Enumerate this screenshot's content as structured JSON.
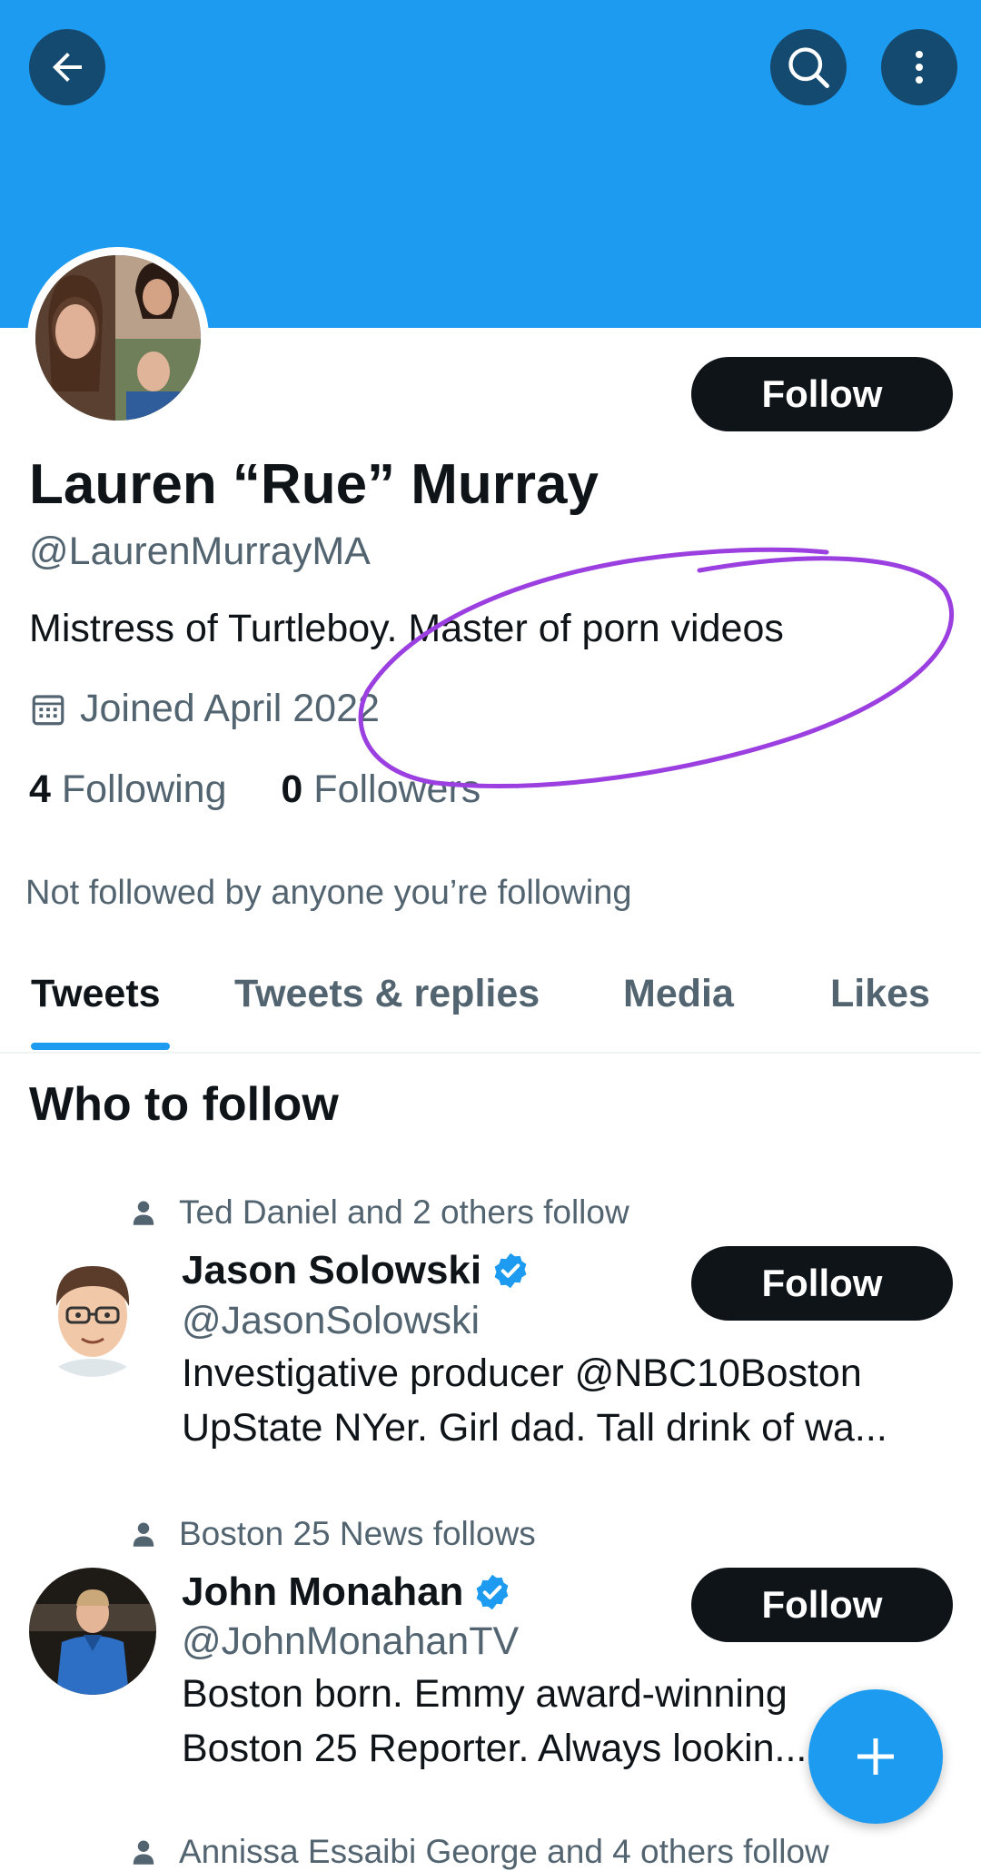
{
  "header": {
    "back_icon": "arrow-left-icon",
    "search_icon": "search-icon",
    "more_icon": "more-vertical-icon",
    "banner_color": "#1d9bf0"
  },
  "profile": {
    "follow_label": "Follow",
    "name": "Lauren “Rue” Murray",
    "handle": "@LaurenMurrayMA",
    "bio": "Mistress of Turtleboy. Master of porn videos",
    "joined": "Joined April 2022",
    "following_count": "4",
    "following_label": "Following",
    "followers_count": "0",
    "followers_label": "Followers",
    "not_followed": "Not followed by anyone you’re following",
    "annotation_color": "#9b3fe0"
  },
  "tabs": [
    {
      "label": "Tweets",
      "active": true
    },
    {
      "label": "Tweets & replies",
      "active": false
    },
    {
      "label": "Media",
      "active": false
    },
    {
      "label": "Likes",
      "active": false
    }
  ],
  "who_to_follow": {
    "title": "Who to follow",
    "suggestions": [
      {
        "context": "Ted Daniel and 2 others follow",
        "name": "Jason Solowski",
        "verified": true,
        "handle": "@JasonSolowski",
        "bio_line1": "Investigative producer @NBC10Boston",
        "bio_line2": "UpState NYer. Girl dad. Tall drink of wa...",
        "follow_label": "Follow"
      },
      {
        "context": "Boston 25 News follows",
        "name": "John Monahan",
        "verified": true,
        "handle": "@JohnMonahanTV",
        "bio_line1": "Boston born. Emmy award-winning",
        "bio_line2": "Boston 25 Reporter. Always lookin...",
        "follow_label": "Follow"
      },
      {
        "context": "Annissa Essaibi George and 4 others follow"
      }
    ]
  },
  "fab": {
    "icon": "compose-plus-icon"
  }
}
